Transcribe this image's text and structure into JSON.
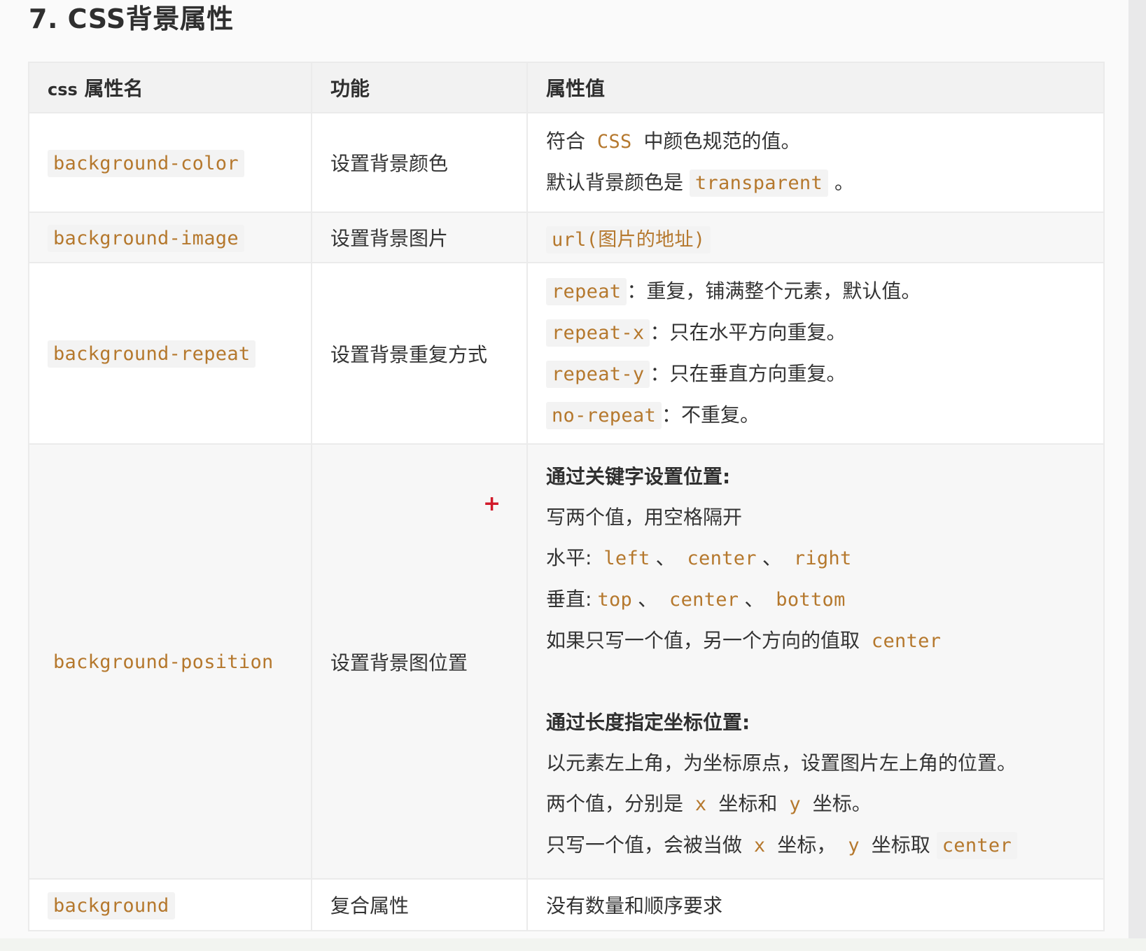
{
  "heading": "7. CSS背景属性",
  "table": {
    "headers": [
      "css 属性名",
      "功能",
      "属性值"
    ],
    "header_abbr": "css",
    "header_rest": "属性名",
    "rows": [
      {
        "name": "background-color",
        "func": "设置背景颜色",
        "value": {
          "l1_pre": "符合",
          "l1_code": "CSS",
          "l1_post": "中颜色规范的值。",
          "l2_pre": "默认背景颜色是",
          "l2_code": "transparent",
          "l2_post": "。"
        }
      },
      {
        "name": "background-image",
        "func": "设置背景图片",
        "value": {
          "code": "url(图片的地址)"
        }
      },
      {
        "name": "background-repeat",
        "func": "设置背景重复方式",
        "value": {
          "items": [
            {
              "code": "repeat",
              "sep": "：",
              "text": "重复，铺满整个元素，默认值。"
            },
            {
              "code": "repeat-x",
              "sep": "：",
              "text": "只在水平方向重复。"
            },
            {
              "code": "repeat-y",
              "sep": "：",
              "text": "只在垂直方向重复。"
            },
            {
              "code": "no-repeat",
              "sep": "：",
              "text": "不重复。"
            }
          ]
        }
      },
      {
        "name": "background-position",
        "func": "设置背景图位置",
        "value": {
          "kw_title": "通过关键字设置位置:",
          "kw_line1": "写两个值，用空格隔开",
          "kw_h_label": "水平:",
          "kw_h_vals": [
            "left",
            "center",
            "right"
          ],
          "kw_v_label": "垂直:",
          "kw_v_vals": [
            "top",
            "center",
            "bottom"
          ],
          "kw_single_pre": "如果只写一个值，另一个方向的值取",
          "kw_single_code": "center",
          "len_title": "通过长度指定坐标位置:",
          "len_line1": "以元素左上角，为坐标原点，设置图片左上角的位置。",
          "len_line2_a": "两个值，分别是",
          "len_line2_x": "x",
          "len_line2_b": "坐标和",
          "len_line2_y": "y",
          "len_line2_c": "坐标。",
          "len_line3_a": "只写一个值，会被当做",
          "len_line3_x": "x",
          "len_line3_b": "坐标，",
          "len_line3_y": "y",
          "len_line3_c": "坐标取",
          "len_line3_code": "center"
        }
      },
      {
        "name": "background",
        "func": "复合属性",
        "value": {
          "text": "没有数量和顺序要求"
        }
      }
    ]
  },
  "separators": {
    "dun": "、"
  },
  "colors": {
    "code_text": "#b5782d",
    "code_bg": "#f3f3f3",
    "header_bg": "#f2f2f2",
    "border": "#ebebeb",
    "cursor": "#d11a2a"
  },
  "cursor_icon": "plus-cursor"
}
